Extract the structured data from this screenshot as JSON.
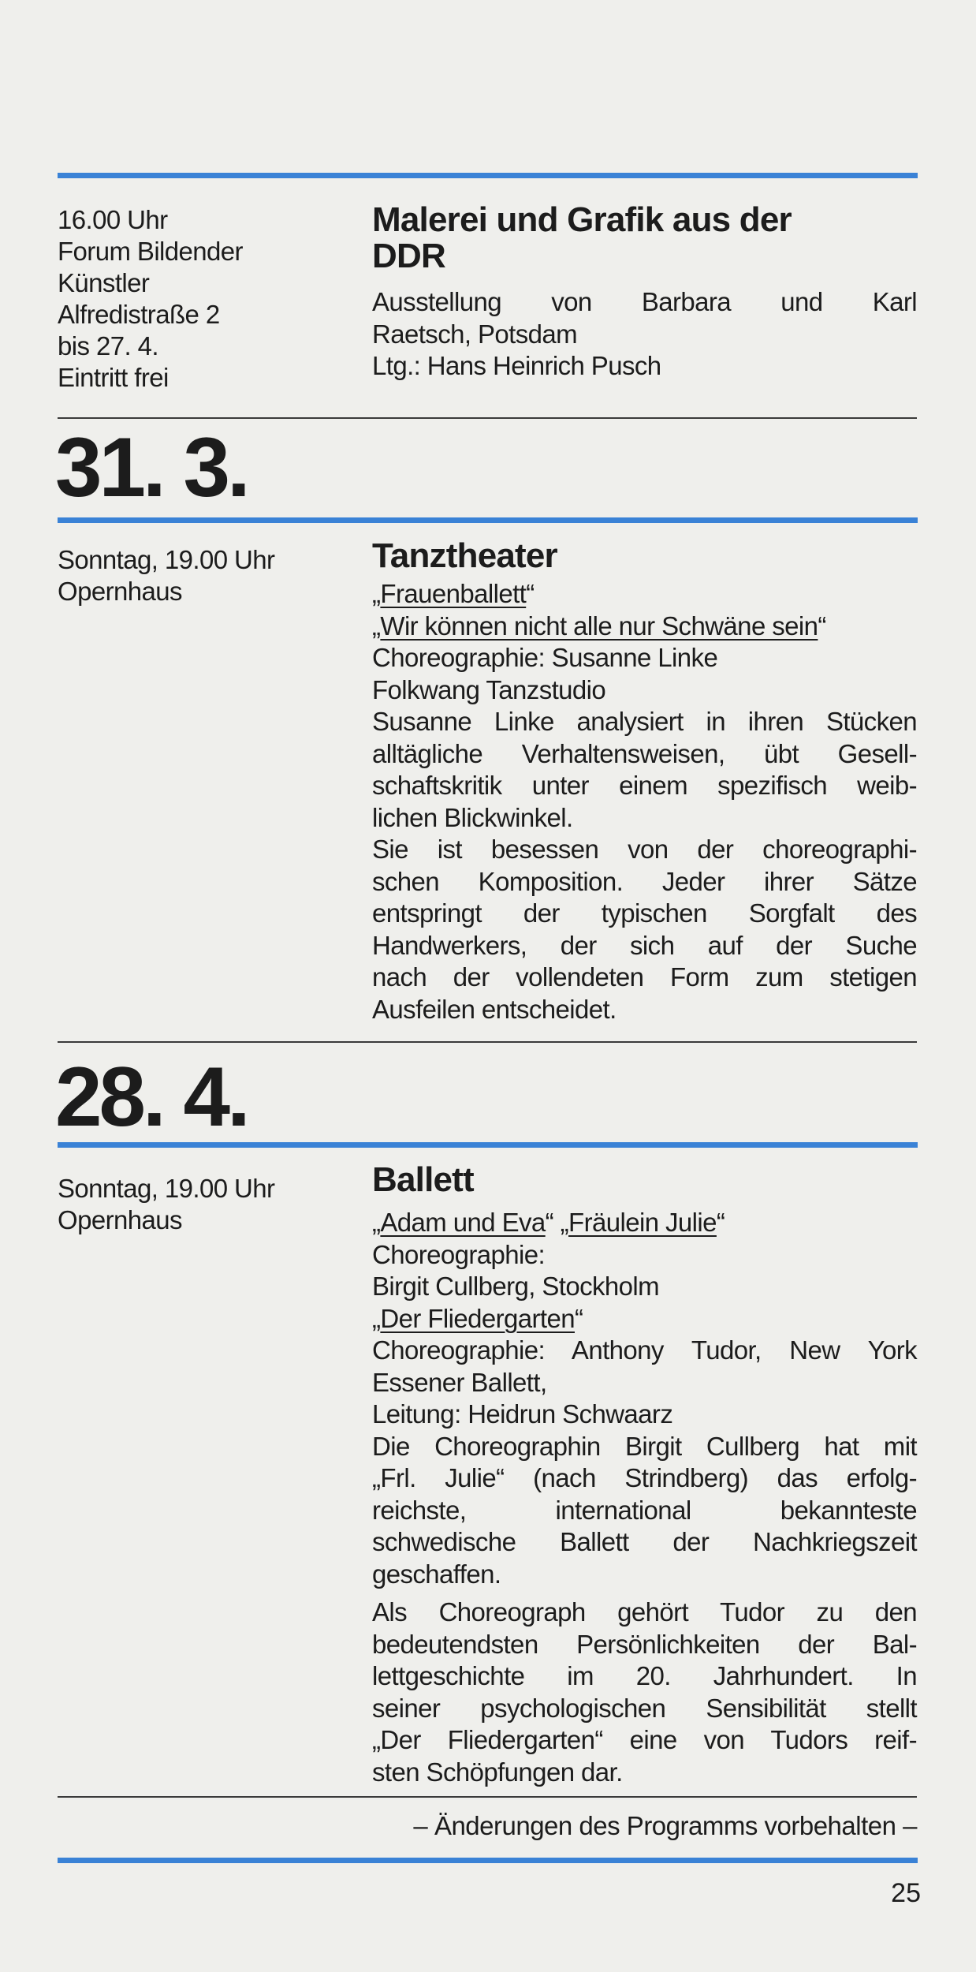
{
  "exhibition": {
    "info": [
      "16.00 Uhr",
      "Forum Bildender",
      "Künstler",
      "Alfredistraße 2",
      "bis 27. 4.",
      "Eintritt frei"
    ],
    "title_lines": [
      "Malerei und Grafik aus der",
      "DDR"
    ],
    "lines": [
      "Ausstellung von Barbara und Karl",
      "Raetsch, Potsdam",
      "Ltg.: Hans Heinrich Pusch"
    ]
  },
  "event1": {
    "date": "31. 3.",
    "info": [
      "Sonntag, 19.00 Uhr",
      "Opernhaus"
    ],
    "title": "Tanztheater",
    "work1": "Frauenballett",
    "work2": "Wir können nicht alle nur Schwäne sein",
    "lines": [
      "Choreographie: Susanne Linke",
      "Folkwang Tanzstudio",
      "Susanne Linke analysiert in ihren Stücken",
      "alltägliche Verhaltensweisen, übt Gesell-",
      "schaftskritik unter einem spezifisch weib-",
      "lichen Blickwinkel.",
      "Sie ist besessen von der choreographi-",
      "schen Komposition. Jeder ihrer Sätze",
      "entspringt der typischen Sorgfalt des",
      "Handwerkers, der sich auf der Suche",
      "nach der vollendeten Form zum stetigen",
      "Ausfeilen entscheidet."
    ]
  },
  "event2": {
    "date": "28. 4.",
    "info": [
      "Sonntag, 19.00 Uhr",
      "Opernhaus"
    ],
    "title": "Ballett",
    "work1": "Adam und Eva",
    "work2": "Fräulein Julie",
    "work3": "Der Fliedergarten",
    "lines": [
      "Choreographie:",
      "Birgit Cullberg, Stockholm",
      "Choreographie: Anthony Tudor, New York",
      "Essener Ballett,",
      "Leitung: Heidrun Schwaarz",
      "Die Choreographin Birgit Cullberg hat mit",
      "„Frl. Julie“ (nach Strindberg) das erfolg-",
      "reichste, international bekannteste",
      "schwedische Ballett der Nachkriegszeit",
      "geschaffen.",
      "Als Choreograph gehört Tudor zu den",
      "bedeutendsten Persönlichkeiten der Bal-",
      "lettgeschichte im 20. Jahrhundert. In",
      "seiner psychologischen Sensibilität stellt",
      "„Der Fliedergarten“ eine von Tudors reif-",
      "sten Schöpfungen dar."
    ]
  },
  "footer": {
    "note": "– Änderungen des Programms vorbehalten –",
    "page_number": "25"
  },
  "quotes": {
    "open": "„",
    "close": "“"
  },
  "colors": {
    "accent_blue": "#3a82d6",
    "rule": "#3a3a3a",
    "paper": "#efefec"
  }
}
